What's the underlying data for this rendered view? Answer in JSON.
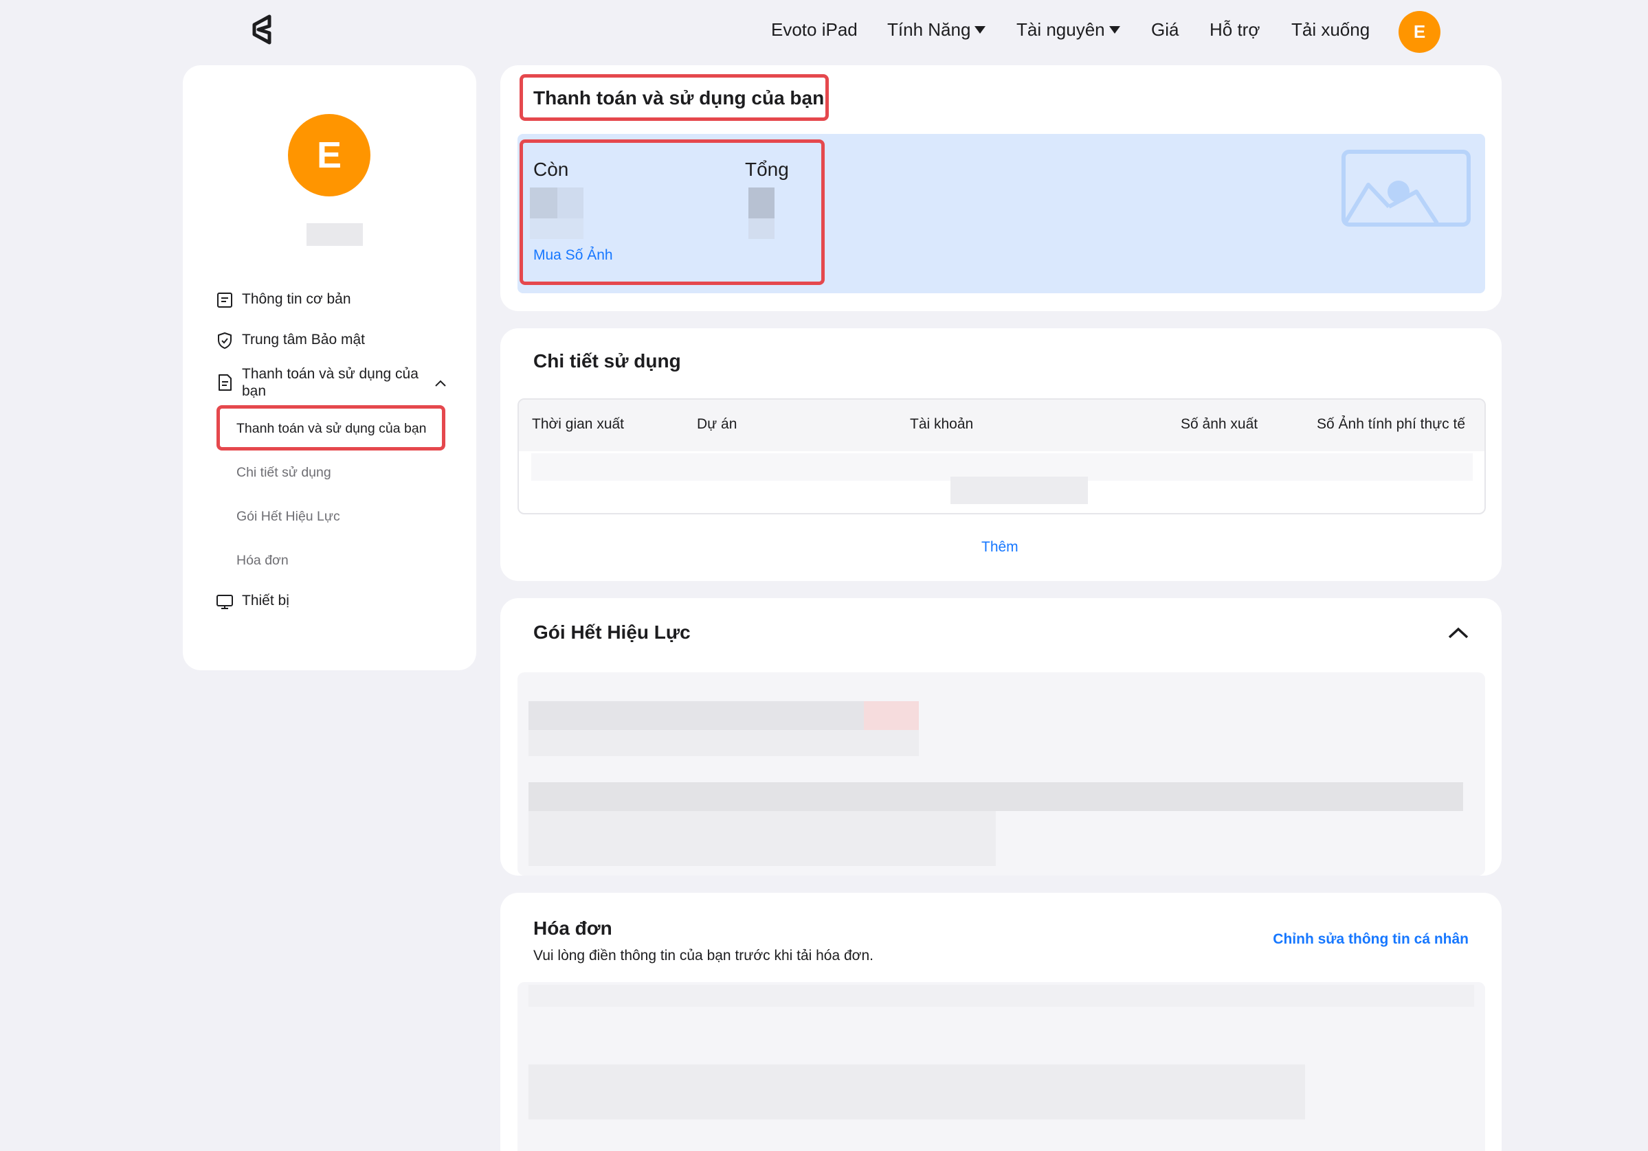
{
  "nav": {
    "items": [
      "Evoto iPad",
      "Tính Năng",
      "Tài nguyên",
      "Giá",
      "Hỗ trợ",
      "Tải xuống"
    ],
    "avatar_letter": "E"
  },
  "sidebar": {
    "avatar_letter": "E",
    "items": [
      {
        "label": "Thông tin cơ bản",
        "icon": "document-icon"
      },
      {
        "label": "Trung tâm Bảo mật",
        "icon": "shield-icon"
      },
      {
        "label": "Thanh toán và sử dụng của bạn",
        "icon": "receipt-icon"
      },
      {
        "label": "Thiết bị",
        "icon": "monitor-icon"
      }
    ],
    "subitems": [
      "Thanh toán và sử dụng của bạn",
      "Chi tiết sử dụng",
      "Gói Hết Hiệu Lực",
      "Hóa đơn"
    ]
  },
  "billing": {
    "title": "Thanh toán và sử dụng của bạn",
    "remaining_label": "Còn",
    "total_label": "Tổng",
    "buy_link": "Mua Số Ảnh"
  },
  "usage": {
    "title": "Chi tiết sử dụng",
    "columns": [
      "Thời gian xuất",
      "Dự án",
      "Tài khoản",
      "Số ảnh xuất",
      "Số Ảnh tính phí thực tế"
    ],
    "more_link": "Thêm"
  },
  "expired": {
    "title": "Gói Hết Hiệu Lực"
  },
  "invoice": {
    "title": "Hóa đơn",
    "subtitle": "Vui lòng điền thông tin của bạn trước khi tải hóa đơn.",
    "edit_link": "Chỉnh sửa thông tin cá nhân"
  },
  "colors": {
    "accent": "#1677ff",
    "avatar": "#ff9500",
    "highlight": "#e5484d",
    "balance_panel": "#dae8fd"
  }
}
